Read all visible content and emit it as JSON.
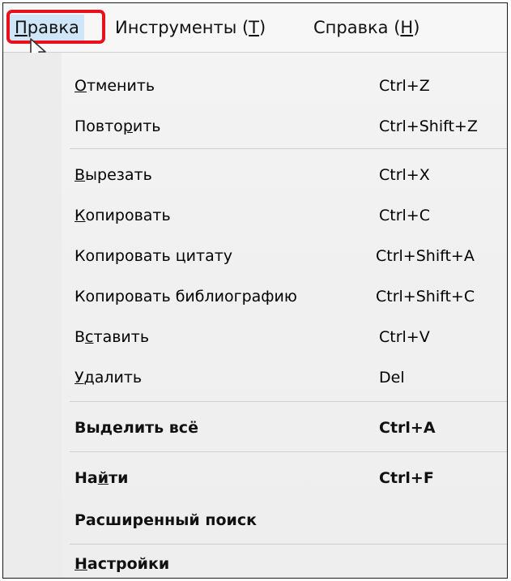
{
  "menubar": {
    "items": [
      {
        "hotkey": "П",
        "rest": "равка",
        "name": "Правка"
      },
      {
        "before": "Инструменты (",
        "hotkey": "Т",
        "after": ")"
      },
      {
        "before": "Справка (",
        "hotkey": "Н",
        "after": ")"
      }
    ]
  },
  "menu": {
    "items": [
      {
        "pre": "",
        "hk": "О",
        "post": "тменить",
        "shortcut": "Ctrl+Z",
        "enabled": false
      },
      {
        "pre": "Повто",
        "hk": "р",
        "post": "ить",
        "shortcut": "Ctrl+Shift+Z",
        "enabled": false
      },
      {
        "pre": "",
        "hk": "В",
        "post": "ырезать",
        "shortcut": "Ctrl+X",
        "enabled": false
      },
      {
        "pre": "",
        "hk": "К",
        "post": "опировать",
        "shortcut": "Ctrl+C",
        "enabled": false
      },
      {
        "pre": "Копировать цитату",
        "hk": "",
        "post": "",
        "shortcut": "Ctrl+Shift+A",
        "enabled": false
      },
      {
        "pre": "Копировать библиографию",
        "hk": "",
        "post": "",
        "shortcut": "Ctrl+Shift+C",
        "enabled": false
      },
      {
        "pre": "В",
        "hk": "с",
        "post": "тавить",
        "shortcut": "Ctrl+V",
        "enabled": false
      },
      {
        "pre": "",
        "hk": "У",
        "post": "далить",
        "shortcut": "Del",
        "enabled": false
      },
      {
        "pre": "Вы",
        "hk": "д",
        "post": "елить всё",
        "shortcut": "Ctrl+A",
        "enabled": true
      },
      {
        "pre": "На",
        "hk": "й",
        "post": "ти",
        "shortcut": "Ctrl+F",
        "enabled": true
      },
      {
        "pre": "Расширенный поиск",
        "hk": "",
        "post": "",
        "shortcut": "",
        "enabled": true
      },
      {
        "pre": "",
        "hk": "Н",
        "post": "астройки",
        "shortcut": "",
        "enabled": true
      }
    ]
  },
  "colors": {
    "highlight_border": "#e8101a",
    "active_menu_bg": "#cfe6f9",
    "disabled_text": "#8a8a8a",
    "enabled_text": "#111111"
  }
}
